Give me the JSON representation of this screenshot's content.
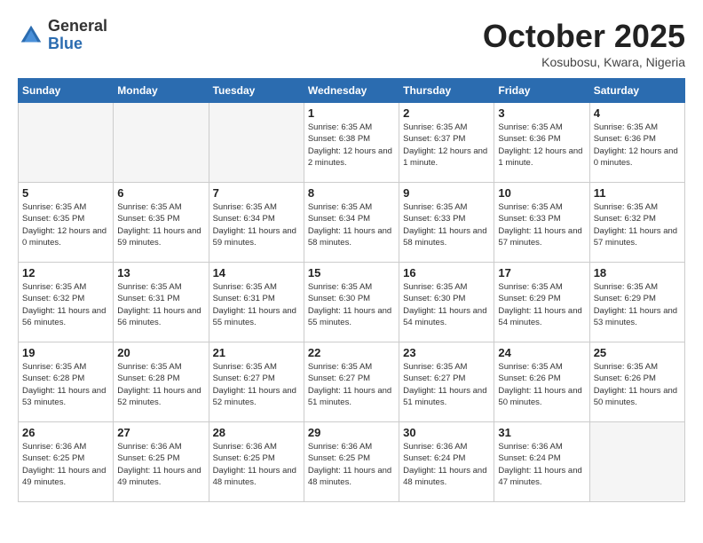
{
  "header": {
    "logo": {
      "line1": "General",
      "line2": "Blue"
    },
    "title": "October 2025",
    "location": "Kosubosu, Kwara, Nigeria"
  },
  "weekdays": [
    "Sunday",
    "Monday",
    "Tuesday",
    "Wednesday",
    "Thursday",
    "Friday",
    "Saturday"
  ],
  "weeks": [
    [
      {
        "day": "",
        "sunrise": "",
        "sunset": "",
        "daylight": "",
        "empty": true
      },
      {
        "day": "",
        "sunrise": "",
        "sunset": "",
        "daylight": "",
        "empty": true
      },
      {
        "day": "",
        "sunrise": "",
        "sunset": "",
        "daylight": "",
        "empty": true
      },
      {
        "day": "1",
        "sunrise": "Sunrise: 6:35 AM",
        "sunset": "Sunset: 6:38 PM",
        "daylight": "Daylight: 12 hours and 2 minutes.",
        "empty": false
      },
      {
        "day": "2",
        "sunrise": "Sunrise: 6:35 AM",
        "sunset": "Sunset: 6:37 PM",
        "daylight": "Daylight: 12 hours and 1 minute.",
        "empty": false
      },
      {
        "day": "3",
        "sunrise": "Sunrise: 6:35 AM",
        "sunset": "Sunset: 6:36 PM",
        "daylight": "Daylight: 12 hours and 1 minute.",
        "empty": false
      },
      {
        "day": "4",
        "sunrise": "Sunrise: 6:35 AM",
        "sunset": "Sunset: 6:36 PM",
        "daylight": "Daylight: 12 hours and 0 minutes.",
        "empty": false
      }
    ],
    [
      {
        "day": "5",
        "sunrise": "Sunrise: 6:35 AM",
        "sunset": "Sunset: 6:35 PM",
        "daylight": "Daylight: 12 hours and 0 minutes.",
        "empty": false
      },
      {
        "day": "6",
        "sunrise": "Sunrise: 6:35 AM",
        "sunset": "Sunset: 6:35 PM",
        "daylight": "Daylight: 11 hours and 59 minutes.",
        "empty": false
      },
      {
        "day": "7",
        "sunrise": "Sunrise: 6:35 AM",
        "sunset": "Sunset: 6:34 PM",
        "daylight": "Daylight: 11 hours and 59 minutes.",
        "empty": false
      },
      {
        "day": "8",
        "sunrise": "Sunrise: 6:35 AM",
        "sunset": "Sunset: 6:34 PM",
        "daylight": "Daylight: 11 hours and 58 minutes.",
        "empty": false
      },
      {
        "day": "9",
        "sunrise": "Sunrise: 6:35 AM",
        "sunset": "Sunset: 6:33 PM",
        "daylight": "Daylight: 11 hours and 58 minutes.",
        "empty": false
      },
      {
        "day": "10",
        "sunrise": "Sunrise: 6:35 AM",
        "sunset": "Sunset: 6:33 PM",
        "daylight": "Daylight: 11 hours and 57 minutes.",
        "empty": false
      },
      {
        "day": "11",
        "sunrise": "Sunrise: 6:35 AM",
        "sunset": "Sunset: 6:32 PM",
        "daylight": "Daylight: 11 hours and 57 minutes.",
        "empty": false
      }
    ],
    [
      {
        "day": "12",
        "sunrise": "Sunrise: 6:35 AM",
        "sunset": "Sunset: 6:32 PM",
        "daylight": "Daylight: 11 hours and 56 minutes.",
        "empty": false
      },
      {
        "day": "13",
        "sunrise": "Sunrise: 6:35 AM",
        "sunset": "Sunset: 6:31 PM",
        "daylight": "Daylight: 11 hours and 56 minutes.",
        "empty": false
      },
      {
        "day": "14",
        "sunrise": "Sunrise: 6:35 AM",
        "sunset": "Sunset: 6:31 PM",
        "daylight": "Daylight: 11 hours and 55 minutes.",
        "empty": false
      },
      {
        "day": "15",
        "sunrise": "Sunrise: 6:35 AM",
        "sunset": "Sunset: 6:30 PM",
        "daylight": "Daylight: 11 hours and 55 minutes.",
        "empty": false
      },
      {
        "day": "16",
        "sunrise": "Sunrise: 6:35 AM",
        "sunset": "Sunset: 6:30 PM",
        "daylight": "Daylight: 11 hours and 54 minutes.",
        "empty": false
      },
      {
        "day": "17",
        "sunrise": "Sunrise: 6:35 AM",
        "sunset": "Sunset: 6:29 PM",
        "daylight": "Daylight: 11 hours and 54 minutes.",
        "empty": false
      },
      {
        "day": "18",
        "sunrise": "Sunrise: 6:35 AM",
        "sunset": "Sunset: 6:29 PM",
        "daylight": "Daylight: 11 hours and 53 minutes.",
        "empty": false
      }
    ],
    [
      {
        "day": "19",
        "sunrise": "Sunrise: 6:35 AM",
        "sunset": "Sunset: 6:28 PM",
        "daylight": "Daylight: 11 hours and 53 minutes.",
        "empty": false
      },
      {
        "day": "20",
        "sunrise": "Sunrise: 6:35 AM",
        "sunset": "Sunset: 6:28 PM",
        "daylight": "Daylight: 11 hours and 52 minutes.",
        "empty": false
      },
      {
        "day": "21",
        "sunrise": "Sunrise: 6:35 AM",
        "sunset": "Sunset: 6:27 PM",
        "daylight": "Daylight: 11 hours and 52 minutes.",
        "empty": false
      },
      {
        "day": "22",
        "sunrise": "Sunrise: 6:35 AM",
        "sunset": "Sunset: 6:27 PM",
        "daylight": "Daylight: 11 hours and 51 minutes.",
        "empty": false
      },
      {
        "day": "23",
        "sunrise": "Sunrise: 6:35 AM",
        "sunset": "Sunset: 6:27 PM",
        "daylight": "Daylight: 11 hours and 51 minutes.",
        "empty": false
      },
      {
        "day": "24",
        "sunrise": "Sunrise: 6:35 AM",
        "sunset": "Sunset: 6:26 PM",
        "daylight": "Daylight: 11 hours and 50 minutes.",
        "empty": false
      },
      {
        "day": "25",
        "sunrise": "Sunrise: 6:35 AM",
        "sunset": "Sunset: 6:26 PM",
        "daylight": "Daylight: 11 hours and 50 minutes.",
        "empty": false
      }
    ],
    [
      {
        "day": "26",
        "sunrise": "Sunrise: 6:36 AM",
        "sunset": "Sunset: 6:25 PM",
        "daylight": "Daylight: 11 hours and 49 minutes.",
        "empty": false
      },
      {
        "day": "27",
        "sunrise": "Sunrise: 6:36 AM",
        "sunset": "Sunset: 6:25 PM",
        "daylight": "Daylight: 11 hours and 49 minutes.",
        "empty": false
      },
      {
        "day": "28",
        "sunrise": "Sunrise: 6:36 AM",
        "sunset": "Sunset: 6:25 PM",
        "daylight": "Daylight: 11 hours and 48 minutes.",
        "empty": false
      },
      {
        "day": "29",
        "sunrise": "Sunrise: 6:36 AM",
        "sunset": "Sunset: 6:25 PM",
        "daylight": "Daylight: 11 hours and 48 minutes.",
        "empty": false
      },
      {
        "day": "30",
        "sunrise": "Sunrise: 6:36 AM",
        "sunset": "Sunset: 6:24 PM",
        "daylight": "Daylight: 11 hours and 48 minutes.",
        "empty": false
      },
      {
        "day": "31",
        "sunrise": "Sunrise: 6:36 AM",
        "sunset": "Sunset: 6:24 PM",
        "daylight": "Daylight: 11 hours and 47 minutes.",
        "empty": false
      },
      {
        "day": "",
        "sunrise": "",
        "sunset": "",
        "daylight": "",
        "empty": true
      }
    ]
  ]
}
